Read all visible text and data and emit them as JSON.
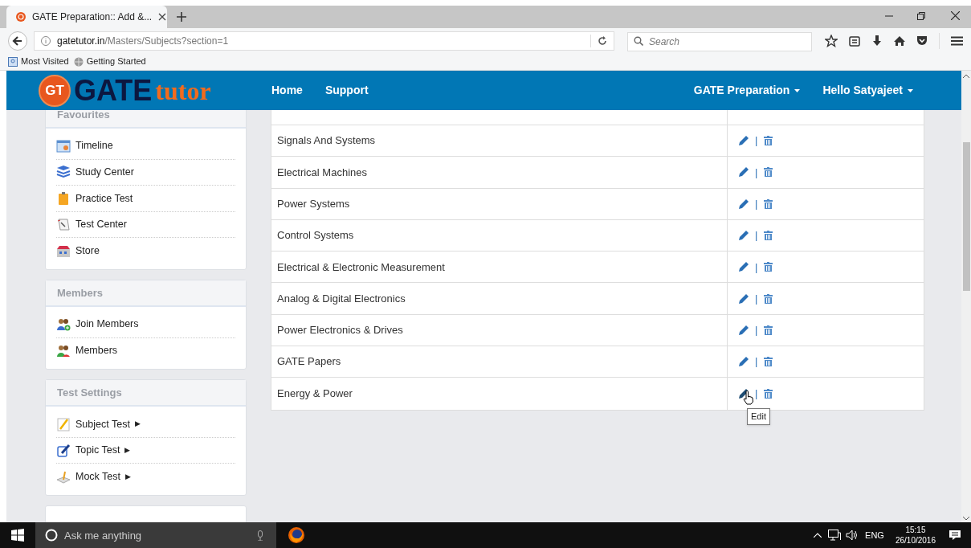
{
  "browser": {
    "tab_title": "GATE Preparation:: Add &...",
    "url_host": "gatetutor.in",
    "url_path": "/Masters/Subjects?section=1",
    "search": {
      "placeholder": "Search"
    },
    "bookmarks": [
      "Most Visited",
      "Getting Started"
    ]
  },
  "site": {
    "logo": {
      "badge": "GT",
      "word1": "GATE",
      "word2": "tutor"
    },
    "nav": [
      "Home",
      "Support"
    ],
    "menus": [
      "GATE Preparation",
      "Hello Satyajeet"
    ]
  },
  "sidebar": [
    {
      "title": "Favourites",
      "items": [
        {
          "label": "Timeline"
        },
        {
          "label": "Study Center"
        },
        {
          "label": "Practice Test"
        },
        {
          "label": "Test Center"
        },
        {
          "label": "Store"
        }
      ]
    },
    {
      "title": "Members",
      "items": [
        {
          "label": "Join Members"
        },
        {
          "label": "Members"
        }
      ]
    },
    {
      "title": "Test Settings",
      "items": [
        {
          "label": "Subject Test",
          "arrow": "▶"
        },
        {
          "label": "Topic Test",
          "arrow": "▶"
        },
        {
          "label": "Mock Test",
          "arrow": "▶"
        }
      ]
    }
  ],
  "subjects": [
    {
      "name": "Signals And Systems",
      "hovered": false
    },
    {
      "name": "Electrical Machines",
      "hovered": false
    },
    {
      "name": "Power Systems",
      "hovered": false
    },
    {
      "name": "Control Systems",
      "hovered": false
    },
    {
      "name": "Electrical & Electronic Measurement",
      "hovered": false
    },
    {
      "name": "Analog & Digital Electronics",
      "hovered": false
    },
    {
      "name": "Power Electronics & Drives",
      "hovered": false
    },
    {
      "name": "GATE Papers",
      "hovered": false
    },
    {
      "name": "Energy & Power",
      "hovered": true
    }
  ],
  "separator": "|",
  "tooltip": "Edit",
  "taskbar": {
    "search_placeholder": "Ask me anything",
    "language": "ENG",
    "time": "15:15",
    "date": "26/10/2016"
  }
}
